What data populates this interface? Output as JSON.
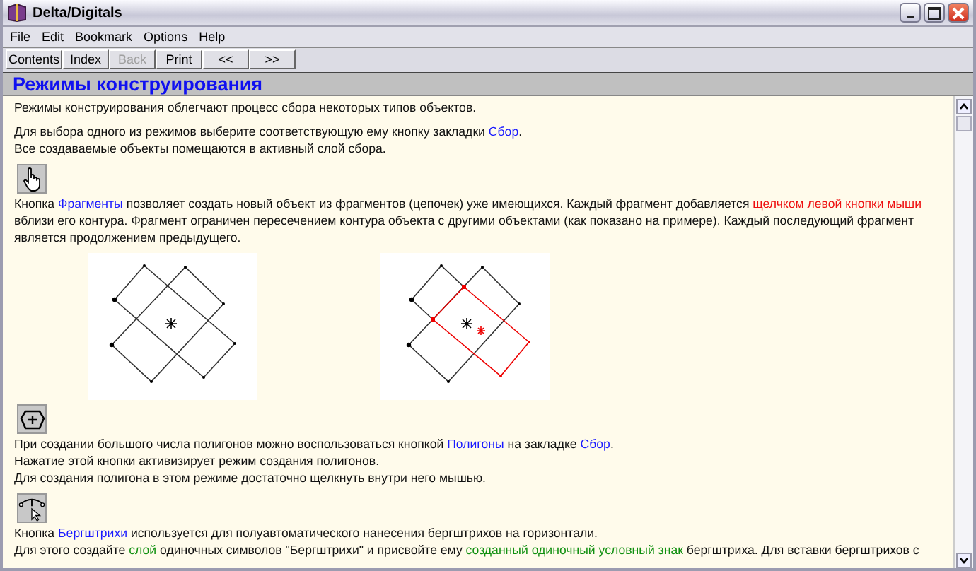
{
  "window": {
    "title": "Delta/Digitals"
  },
  "menu": [
    "File",
    "Edit",
    "Bookmark",
    "Options",
    "Help"
  ],
  "toolbar": [
    {
      "label": "Contents",
      "disabled": false
    },
    {
      "label": "Index",
      "disabled": false
    },
    {
      "label": "Back",
      "disabled": true
    },
    {
      "label": "Print",
      "disabled": false
    },
    {
      "label": "<<",
      "disabled": false
    },
    {
      "label": ">>",
      "disabled": false
    }
  ],
  "heading": "Режимы конструирования",
  "blocks": [
    {
      "kind": "text",
      "lines": [
        [
          {
            "kind": "plain",
            "text": "Режимы конструирования облегчают процесс сбора некоторых типов объектов."
          }
        ]
      ]
    },
    {
      "kind": "text",
      "lines": [
        [
          {
            "kind": "plain",
            "text": "Для выбора одного из режимов выберите соответствующую ему кнопку закладки "
          },
          {
            "kind": "link",
            "text": "Сбор"
          },
          {
            "kind": "plain",
            "text": "."
          }
        ],
        [
          {
            "kind": "plain",
            "text": "Все создаваемые объекты помещаются в активный слой сбора."
          }
        ]
      ]
    },
    {
      "kind": "hand-tool"
    },
    {
      "kind": "text",
      "lines": [
        [
          {
            "kind": "plain",
            "text": "Кнопка "
          },
          {
            "kind": "link",
            "text": "Фрагменты"
          },
          {
            "kind": "plain",
            "text": " позволяет создать новый объект из фрагментов (цепочек) уже имеющихся. Каждый фрагмент добавляется "
          },
          {
            "kind": "action",
            "text": "щелчком левой кнопки мыши"
          },
          {
            "kind": "plain",
            "text": " вблизи его контура. Фрагмент ограничен пересечением контура объекта с другими объектами (как показано на примере). Каждый последующий фрагмент является продолжением предыдущего."
          }
        ]
      ]
    },
    {
      "kind": "figures"
    },
    {
      "kind": "polygon-tool"
    },
    {
      "kind": "text",
      "lines": [
        [
          {
            "kind": "plain",
            "text": "При создании большого числа полигонов можно воспользоваться кнопкой "
          },
          {
            "kind": "link",
            "text": "Полигоны"
          },
          {
            "kind": "plain",
            "text": " на закладке "
          },
          {
            "kind": "link",
            "text": "Сбор"
          },
          {
            "kind": "plain",
            "text": "."
          }
        ],
        [
          {
            "kind": "plain",
            "text": "Нажатие этой кнопки активизирует режим создания полигонов."
          }
        ],
        [
          {
            "kind": "plain",
            "text": "Для создания полигона в этом режиме достаточно щелкнуть внутри него мышью."
          }
        ]
      ]
    },
    {
      "kind": "hatch-tool"
    },
    {
      "kind": "text",
      "lines": [
        [
          {
            "kind": "plain",
            "text": "Кнопка "
          },
          {
            "kind": "link",
            "text": "Бергштрихи"
          },
          {
            "kind": "plain",
            "text": " используется для полуавтоматического нанесения бергштрихов на горизонтали."
          }
        ],
        [
          {
            "kind": "plain",
            "text": "Для этого создайте "
          },
          {
            "kind": "term",
            "text": "слой"
          },
          {
            "kind": "plain",
            "text": " одиночных символов \"Бергштрихи\" и присвойте ему "
          },
          {
            "kind": "term",
            "text": "созданный одиночный условный знак"
          },
          {
            "kind": "plain",
            "text": " бергштриха. Для вставки бергштрихов с"
          }
        ]
      ]
    }
  ]
}
